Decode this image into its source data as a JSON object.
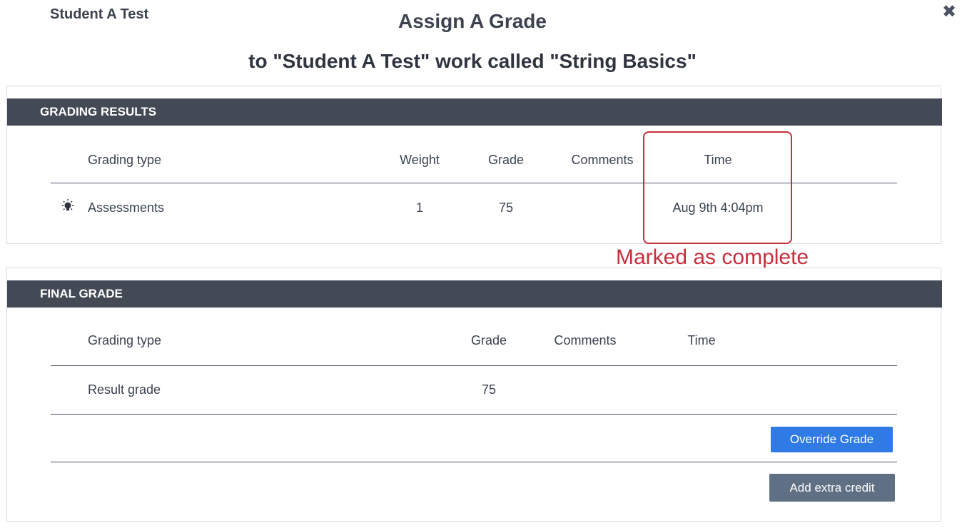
{
  "header": {
    "student_name": "Student A Test",
    "title": "Assign A Grade",
    "subtitle": "to \"Student A Test\" work called \"String Basics\"",
    "close_icon": "close-icon"
  },
  "grading_results": {
    "heading": "GRADING RESULTS",
    "columns": {
      "grading_type": "Grading type",
      "weight": "Weight",
      "grade": "Grade",
      "comments": "Comments",
      "time": "Time"
    },
    "rows": [
      {
        "icon": "lightbulb-icon",
        "grading_type": "Assessments",
        "weight": "1",
        "grade": "75",
        "comments": "",
        "time": "Aug 9th 4:04pm"
      }
    ]
  },
  "annotation": {
    "text": "Marked as complete",
    "color": "#c62f3b"
  },
  "final_grade": {
    "heading": "FINAL GRADE",
    "columns": {
      "grading_type": "Grading type",
      "grade": "Grade",
      "comments": "Comments",
      "time": "Time"
    },
    "rows": [
      {
        "grading_type": "Result grade",
        "grade": "75",
        "comments": "",
        "time": ""
      }
    ],
    "override_label": "Override Grade",
    "extra_credit_label": "Add extra credit"
  },
  "colors": {
    "panel_header": "#434955",
    "primary_button": "#2f7ae5",
    "secondary_button": "#5f6f84"
  }
}
